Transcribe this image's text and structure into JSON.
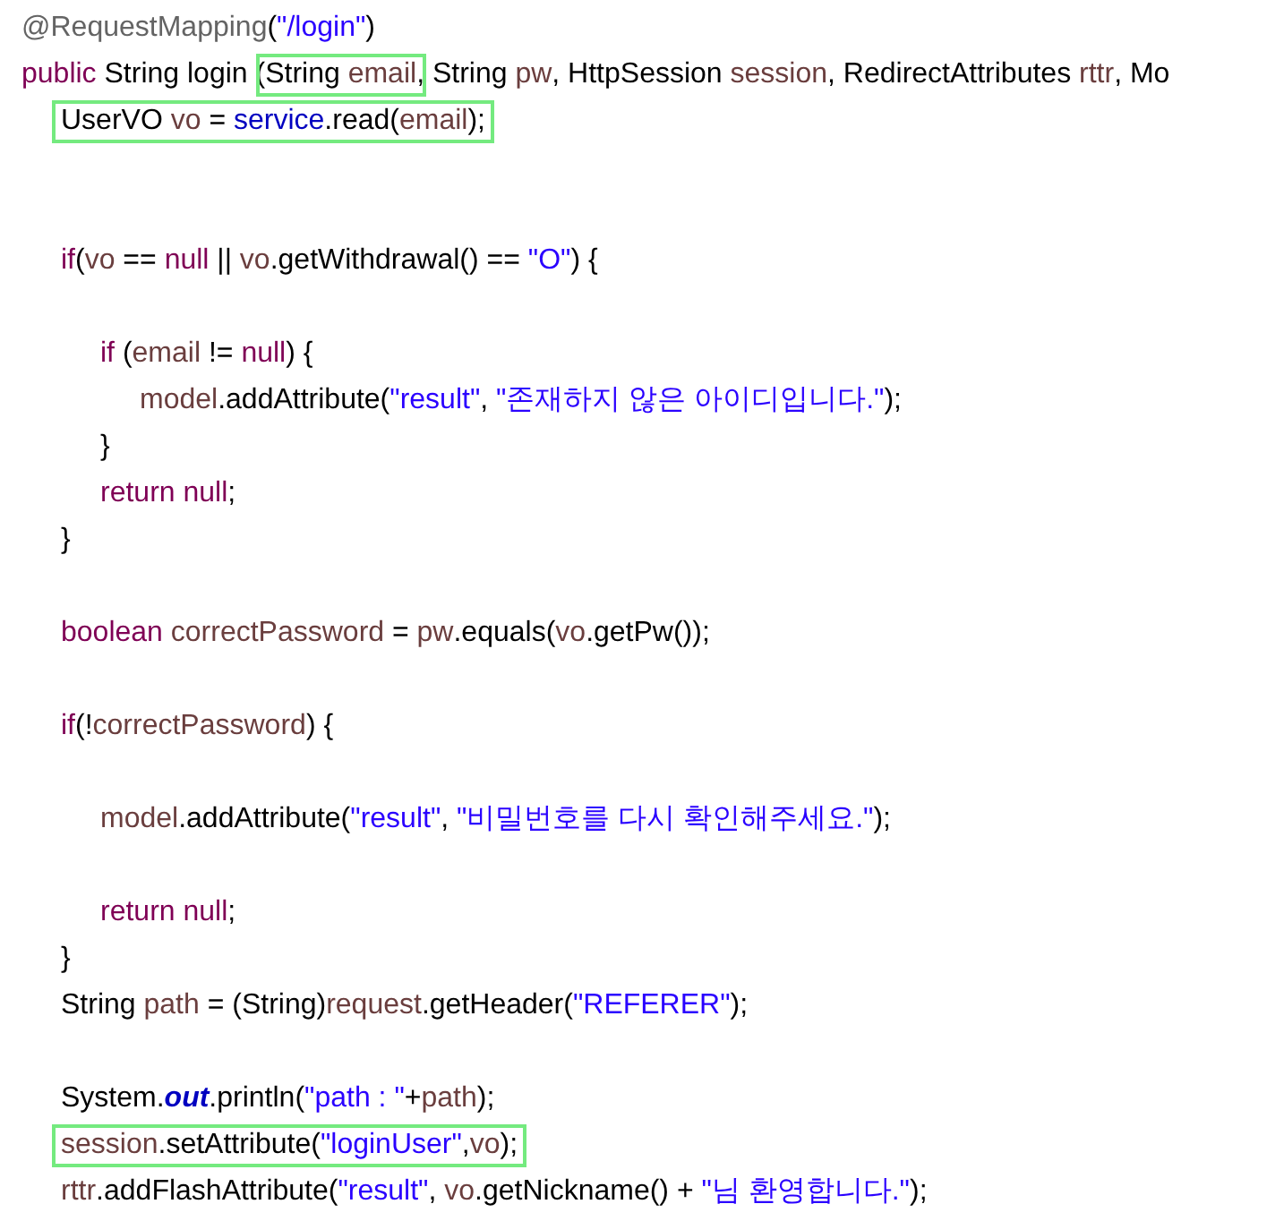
{
  "code_lines": [
    {
      "kind": "code",
      "tokens": [
        {
          "kind": "annotation",
          "text": "@RequestMapping"
        },
        {
          "kind": "plain",
          "text": "("
        },
        {
          "kind": "string",
          "text": "\"/login\""
        },
        {
          "kind": "plain",
          "text": ")"
        }
      ]
    },
    {
      "kind": "code",
      "tokens": [
        {
          "kind": "keyword",
          "text": "public"
        },
        {
          "kind": "plain",
          "text": " String login ("
        },
        {
          "kind": "box",
          "tokens": [
            {
              "kind": "plain",
              "text": "String "
            },
            {
              "kind": "variable",
              "text": "email"
            }
          ]
        },
        {
          "kind": "plain",
          "text": ", String "
        },
        {
          "kind": "variable",
          "text": "pw"
        },
        {
          "kind": "plain",
          "text": ", HttpSession "
        },
        {
          "kind": "variable",
          "text": "session"
        },
        {
          "kind": "plain",
          "text": ", RedirectAttributes "
        },
        {
          "kind": "variable",
          "text": "rttr"
        },
        {
          "kind": "plain",
          "text": ", Mo"
        }
      ],
      "children": [
        {
          "kind": "code",
          "tokens": [
            {
              "kind": "box",
              "tokens": [
                {
                  "kind": "plain",
                  "text": "UserVO "
                },
                {
                  "kind": "variable",
                  "text": "vo"
                },
                {
                  "kind": "plain",
                  "text": " = "
                },
                {
                  "kind": "field",
                  "text": "service"
                },
                {
                  "kind": "plain",
                  "text": ".read("
                },
                {
                  "kind": "variable",
                  "text": "email"
                },
                {
                  "kind": "plain",
                  "text": ");"
                }
              ]
            }
          ]
        },
        {
          "kind": "blank"
        },
        {
          "kind": "blank"
        },
        {
          "kind": "code",
          "tokens": [
            {
              "kind": "keyword",
              "text": "if"
            },
            {
              "kind": "plain",
              "text": "("
            },
            {
              "kind": "variable",
              "text": "vo"
            },
            {
              "kind": "plain",
              "text": " == "
            },
            {
              "kind": "keyword",
              "text": "null"
            },
            {
              "kind": "plain",
              "text": " || "
            },
            {
              "kind": "variable",
              "text": "vo"
            },
            {
              "kind": "plain",
              "text": ".getWithdrawal() == "
            },
            {
              "kind": "string",
              "text": "\"O\""
            },
            {
              "kind": "plain",
              "text": ") {"
            }
          ],
          "children": [
            {
              "kind": "blank"
            },
            {
              "kind": "code",
              "tokens": [
                {
                  "kind": "keyword",
                  "text": "if"
                },
                {
                  "kind": "plain",
                  "text": " ("
                },
                {
                  "kind": "variable",
                  "text": "email"
                },
                {
                  "kind": "plain",
                  "text": " != "
                },
                {
                  "kind": "keyword",
                  "text": "null"
                },
                {
                  "kind": "plain",
                  "text": ") {"
                }
              ],
              "children": [
                {
                  "kind": "code",
                  "tokens": [
                    {
                      "kind": "variable",
                      "text": "model"
                    },
                    {
                      "kind": "plain",
                      "text": ".addAttribute("
                    },
                    {
                      "kind": "string",
                      "text": "\"result\""
                    },
                    {
                      "kind": "string",
                      "lead": ", ",
                      "text": "\"존재하지 않은 아이디입니다.\""
                    },
                    {
                      "kind": "plain",
                      "text": ");"
                    }
                  ]
                }
              ]
            },
            {
              "kind": "code",
              "tokens": [
                {
                  "kind": "plain",
                  "text": "}"
                }
              ]
            },
            {
              "kind": "code",
              "tokens": [
                {
                  "kind": "keyword",
                  "text": "return null"
                },
                {
                  "kind": "plain",
                  "text": ";"
                }
              ]
            }
          ]
        },
        {
          "kind": "code",
          "tokens": [
            {
              "kind": "plain",
              "text": "}"
            }
          ]
        },
        {
          "kind": "blank"
        },
        {
          "kind": "code",
          "tokens": [
            {
              "kind": "keyword",
              "text": "boolean "
            },
            {
              "kind": "variable",
              "text": "correctPassword"
            },
            {
              "kind": "plain",
              "text": " = "
            },
            {
              "kind": "variable",
              "text": "pw"
            },
            {
              "kind": "plain",
              "text": ".equals("
            },
            {
              "kind": "variable",
              "text": "vo"
            },
            {
              "kind": "plain",
              "text": ".getPw());"
            }
          ]
        },
        {
          "kind": "blank"
        },
        {
          "kind": "code",
          "tokens": [
            {
              "kind": "keyword",
              "text": "if"
            },
            {
              "kind": "plain",
              "text": "(!"
            },
            {
              "kind": "variable",
              "text": "correctPassword"
            },
            {
              "kind": "plain",
              "text": ") {"
            }
          ],
          "children": [
            {
              "kind": "blank"
            },
            {
              "kind": "code",
              "tokens": [
                {
                  "kind": "variable",
                  "text": "model"
                },
                {
                  "kind": "plain",
                  "text": ".addAttribute("
                },
                {
                  "kind": "string",
                  "text": "\"result\""
                },
                {
                  "kind": "string",
                  "lead": ", ",
                  "text": "\"비밀번호를 다시 확인해주세요.\""
                },
                {
                  "kind": "plain",
                  "text": ");"
                }
              ]
            },
            {
              "kind": "blank"
            },
            {
              "kind": "code",
              "tokens": [
                {
                  "kind": "keyword",
                  "text": "return null"
                },
                {
                  "kind": "plain",
                  "text": ";"
                }
              ]
            }
          ]
        },
        {
          "kind": "code",
          "tokens": [
            {
              "kind": "plain",
              "text": "}"
            }
          ]
        },
        {
          "kind": "code",
          "tokens": [
            {
              "kind": "plain",
              "text": "String "
            },
            {
              "kind": "variable",
              "text": "path"
            },
            {
              "kind": "plain",
              "text": " = (String)"
            },
            {
              "kind": "variable",
              "text": "request"
            },
            {
              "kind": "plain",
              "text": ".getHeader("
            },
            {
              "kind": "string",
              "text": "\"REFERER\""
            },
            {
              "kind": "plain",
              "text": ");"
            }
          ]
        },
        {
          "kind": "blank"
        },
        {
          "kind": "code",
          "tokens": [
            {
              "kind": "plain",
              "text": "System."
            },
            {
              "kind": "static",
              "text": "out"
            },
            {
              "kind": "plain",
              "text": ".println("
            },
            {
              "kind": "string",
              "text": "\"path : \""
            },
            {
              "kind": "plain",
              "text": "+"
            },
            {
              "kind": "variable",
              "text": "path"
            },
            {
              "kind": "plain",
              "text": ");"
            }
          ]
        },
        {
          "kind": "code",
          "tokens": [
            {
              "kind": "box",
              "tokens": [
                {
                  "kind": "variable",
                  "text": "session"
                },
                {
                  "kind": "plain",
                  "text": ".setAttribute("
                },
                {
                  "kind": "string",
                  "text": "\"loginUser\""
                },
                {
                  "kind": "plain",
                  "text": ","
                },
                {
                  "kind": "variable",
                  "text": "vo"
                },
                {
                  "kind": "plain",
                  "text": ");"
                }
              ]
            }
          ]
        },
        {
          "kind": "code",
          "tokens": [
            {
              "kind": "variable",
              "text": "rttr"
            },
            {
              "kind": "plain",
              "text": ".addFlashAttribute("
            },
            {
              "kind": "string",
              "text": "\"result\""
            },
            {
              "kind": "plain",
              "text": ", "
            },
            {
              "kind": "variable",
              "text": "vo"
            },
            {
              "kind": "plain",
              "text": ".getNickname() + "
            },
            {
              "kind": "string",
              "text": "\"님 환영합니다.\""
            },
            {
              "kind": "plain",
              "text": ");"
            }
          ]
        }
      ]
    }
  ]
}
